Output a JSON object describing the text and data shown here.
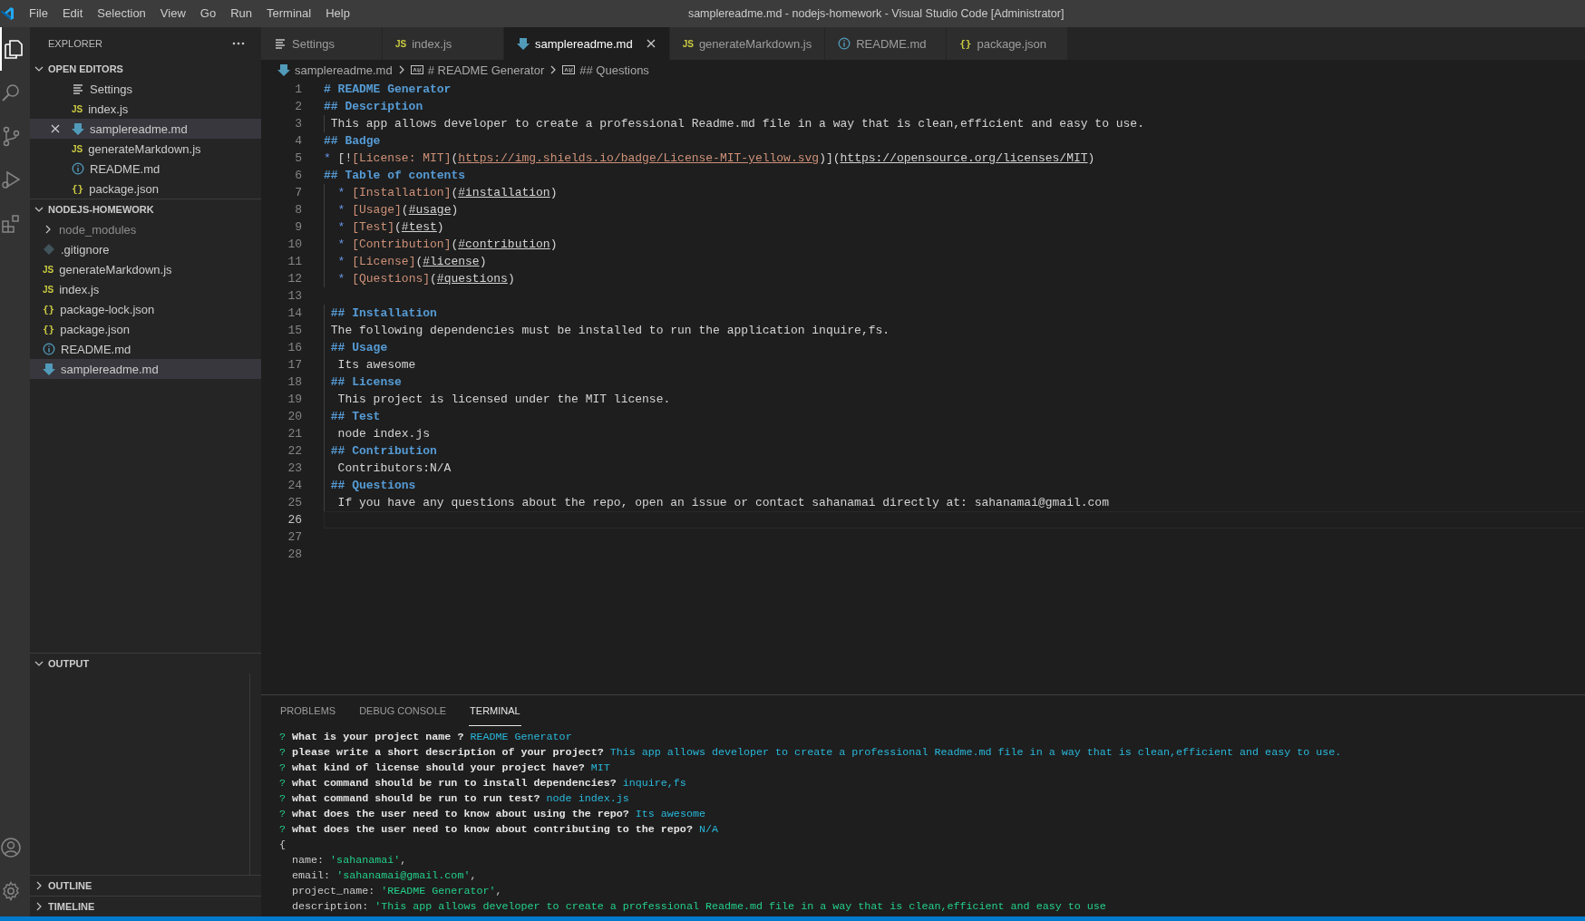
{
  "title_bar": {
    "menu": [
      "File",
      "Edit",
      "Selection",
      "View",
      "Go",
      "Run",
      "Terminal",
      "Help"
    ],
    "title": "samplereadme.md - nodejs-homework - Visual Studio Code [Administrator]"
  },
  "activity_bar": {
    "items": [
      {
        "kind": "files",
        "selected": true
      },
      {
        "kind": "search",
        "selected": false
      },
      {
        "kind": "source-control",
        "selected": false
      },
      {
        "kind": "run",
        "selected": false
      },
      {
        "kind": "extensions",
        "selected": false
      }
    ],
    "bottom": [
      {
        "kind": "account"
      },
      {
        "kind": "settings"
      }
    ]
  },
  "sidebar": {
    "title": "EXPLORER",
    "sections": [
      {
        "title": "OPEN EDITORS",
        "expanded": true,
        "items": [
          {
            "label": "Settings",
            "kind": "settings",
            "selected": false
          },
          {
            "label": "index.js",
            "kind": "js",
            "badge": "JS",
            "selected": false
          },
          {
            "label": "samplereadme.md",
            "kind": "markdown",
            "selected": true
          },
          {
            "label": "generateMarkdown.js",
            "kind": "js",
            "badge": "JS",
            "selected": false
          },
          {
            "label": "README.md",
            "kind": "info",
            "selected": false
          },
          {
            "label": "package.json",
            "kind": "json",
            "badge": "{}",
            "selected": false
          }
        ]
      },
      {
        "title": "NODEJS-HOMEWORK",
        "expanded": true,
        "items": [
          {
            "label": "node_modules",
            "kind": "folder",
            "expanded": false,
            "ignored": true,
            "selected": false
          },
          {
            "label": ".gitignore",
            "kind": "gitignore",
            "ignored": false,
            "selected": false
          },
          {
            "label": "generateMarkdown.js",
            "kind": "js",
            "badge": "JS",
            "ignored": false,
            "selected": false
          },
          {
            "label": "index.js",
            "kind": "js",
            "badge": "JS",
            "ignored": false,
            "selected": false
          },
          {
            "label": "package-lock.json",
            "kind": "json",
            "badge": "{}",
            "ignored": false,
            "selected": false
          },
          {
            "label": "package.json",
            "kind": "json",
            "badge": "{}",
            "ignored": false,
            "selected": false
          },
          {
            "label": "README.md",
            "kind": "info",
            "ignored": false,
            "selected": false
          },
          {
            "label": "samplereadme.md",
            "kind": "markdown",
            "ignored": false,
            "selected": true
          }
        ]
      },
      {
        "title": "OUTPUT",
        "expanded": true
      },
      {
        "title": "OUTLINE",
        "expanded": false
      },
      {
        "title": "TIMELINE",
        "expanded": false
      }
    ]
  },
  "editor": {
    "tabs": [
      {
        "label": "Settings",
        "kind": "settings",
        "selected": false
      },
      {
        "label": "index.js",
        "kind": "js",
        "badge": "JS",
        "selected": false
      },
      {
        "label": "samplereadme.md",
        "kind": "markdown",
        "selected": true
      },
      {
        "label": "generateMarkdown.js",
        "kind": "js",
        "badge": "JS",
        "selected": false
      },
      {
        "label": "README.md",
        "kind": "info",
        "selected": false
      },
      {
        "label": "package.json",
        "kind": "json",
        "badge": "{}",
        "selected": false
      }
    ],
    "breadcrumb": [
      {
        "label": "samplereadme.md",
        "kind": "markdown"
      },
      {
        "label": "# README Generator",
        "kind": "symbol"
      },
      {
        "label": "## Questions",
        "kind": "symbol"
      }
    ],
    "lines": [
      {
        "number": "1",
        "current": false,
        "indent_guide": false,
        "segments": [
          {
            "kind": "heading",
            "text": "# README Generator"
          }
        ]
      },
      {
        "number": "2",
        "current": false,
        "indent_guide": false,
        "segments": [
          {
            "kind": "heading",
            "text": "## Description"
          }
        ]
      },
      {
        "number": "3",
        "current": false,
        "indent_guide": true,
        "segments": [
          {
            "kind": "plain",
            "text": " This app allows developer to create a professional Readme.md file in a way that is clean,efficient and easy to use."
          }
        ]
      },
      {
        "number": "4",
        "current": false,
        "indent_guide": false,
        "segments": [
          {
            "kind": "heading",
            "text": "## Badge"
          }
        ]
      },
      {
        "number": "5",
        "current": false,
        "indent_guide": false,
        "segments": [
          {
            "kind": "bullet",
            "text": "* "
          },
          {
            "kind": "plain",
            "text": "[!"
          },
          {
            "kind": "link_text",
            "text": "[License: MIT]"
          },
          {
            "kind": "plain",
            "text": "("
          },
          {
            "kind": "image_url",
            "text": "https://img.shields.io/badge/License-MIT-yellow.svg"
          },
          {
            "kind": "plain",
            "text": ")]("
          },
          {
            "kind": "link_url",
            "text": "https://opensource.org/licenses/MIT"
          },
          {
            "kind": "plain",
            "text": ")"
          }
        ]
      },
      {
        "number": "6",
        "current": false,
        "indent_guide": false,
        "segments": [
          {
            "kind": "heading",
            "text": "## Table of contents"
          }
        ]
      },
      {
        "number": "7",
        "current": false,
        "indent_guide": true,
        "segments": [
          {
            "kind": "bullet",
            "text": "  * "
          },
          {
            "kind": "link_text",
            "text": "[Installation]"
          },
          {
            "kind": "plain",
            "text": "("
          },
          {
            "kind": "link_url",
            "text": "#installation"
          },
          {
            "kind": "plain",
            "text": ")"
          }
        ]
      },
      {
        "number": "8",
        "current": false,
        "indent_guide": true,
        "segments": [
          {
            "kind": "bullet",
            "text": "  * "
          },
          {
            "kind": "link_text",
            "text": "[Usage]"
          },
          {
            "kind": "plain",
            "text": "("
          },
          {
            "kind": "link_url",
            "text": "#usage"
          },
          {
            "kind": "plain",
            "text": ")"
          }
        ]
      },
      {
        "number": "9",
        "current": false,
        "indent_guide": true,
        "segments": [
          {
            "kind": "bullet",
            "text": "  * "
          },
          {
            "kind": "link_text",
            "text": "[Test]"
          },
          {
            "kind": "plain",
            "text": "("
          },
          {
            "kind": "link_url",
            "text": "#test"
          },
          {
            "kind": "plain",
            "text": ")"
          }
        ]
      },
      {
        "number": "10",
        "current": false,
        "indent_guide": true,
        "segments": [
          {
            "kind": "bullet",
            "text": "  * "
          },
          {
            "kind": "link_text",
            "text": "[Contribution]"
          },
          {
            "kind": "plain",
            "text": "("
          },
          {
            "kind": "link_url",
            "text": "#contribution"
          },
          {
            "kind": "plain",
            "text": ")"
          }
        ]
      },
      {
        "number": "11",
        "current": false,
        "indent_guide": true,
        "segments": [
          {
            "kind": "bullet",
            "text": "  * "
          },
          {
            "kind": "link_text",
            "text": "[License]"
          },
          {
            "kind": "plain",
            "text": "("
          },
          {
            "kind": "link_url",
            "text": "#license"
          },
          {
            "kind": "plain",
            "text": ")"
          }
        ]
      },
      {
        "number": "12",
        "current": false,
        "indent_guide": true,
        "segments": [
          {
            "kind": "bullet",
            "text": "  * "
          },
          {
            "kind": "link_text",
            "text": "[Questions]"
          },
          {
            "kind": "plain",
            "text": "("
          },
          {
            "kind": "link_url",
            "text": "#questions"
          },
          {
            "kind": "plain",
            "text": ")"
          }
        ]
      },
      {
        "number": "13",
        "current": false,
        "indent_guide": false
      },
      {
        "number": "14",
        "current": false,
        "indent_guide": true,
        "segments": [
          {
            "kind": "heading",
            "text": " ## Installation"
          }
        ]
      },
      {
        "number": "15",
        "current": false,
        "indent_guide": true,
        "segments": [
          {
            "kind": "plain",
            "text": " The following dependencies must be installed to run the application inquire,fs."
          }
        ]
      },
      {
        "number": "16",
        "current": false,
        "indent_guide": true,
        "segments": [
          {
            "kind": "heading",
            "text": " ## Usage"
          }
        ]
      },
      {
        "number": "17",
        "current": false,
        "indent_guide": true,
        "segments": [
          {
            "kind": "plain",
            "text": "  Its awesome"
          }
        ]
      },
      {
        "number": "18",
        "current": false,
        "indent_guide": true,
        "segments": [
          {
            "kind": "heading",
            "text": " ## License"
          }
        ]
      },
      {
        "number": "19",
        "current": false,
        "indent_guide": true,
        "segments": [
          {
            "kind": "plain",
            "text": "  This project is licensed under the MIT license."
          }
        ]
      },
      {
        "number": "20",
        "current": false,
        "indent_guide": true,
        "segments": [
          {
            "kind": "heading",
            "text": " ## Test"
          }
        ]
      },
      {
        "number": "21",
        "current": false,
        "indent_guide": true,
        "segments": [
          {
            "kind": "plain",
            "text": "  node index.js"
          }
        ]
      },
      {
        "number": "22",
        "current": false,
        "indent_guide": true,
        "segments": [
          {
            "kind": "heading",
            "text": " ## Contribution"
          }
        ]
      },
      {
        "number": "23",
        "current": false,
        "indent_guide": true,
        "segments": [
          {
            "kind": "plain",
            "text": "  Contributors:N/A"
          }
        ]
      },
      {
        "number": "24",
        "current": false,
        "indent_guide": true,
        "segments": [
          {
            "kind": "heading",
            "text": " ## Questions"
          }
        ]
      },
      {
        "number": "25",
        "current": false,
        "indent_guide": true,
        "segments": [
          {
            "kind": "plain",
            "text": "  If you have any questions about the repo, open an issue or contact sahanamai directly at: sahanamai@gmail.com"
          }
        ]
      },
      {
        "number": "26",
        "current": true,
        "indent_guide": false
      },
      {
        "number": "27",
        "current": false,
        "indent_guide": false
      },
      {
        "number": "28",
        "current": false,
        "indent_guide": false
      }
    ]
  },
  "panel": {
    "tabs": [
      {
        "label": "PROBLEMS",
        "selected": false
      },
      {
        "label": "DEBUG CONSOLE",
        "selected": false
      },
      {
        "label": "TERMINAL",
        "selected": true
      }
    ],
    "terminal": [
      {
        "kind": "prompt",
        "mark": "?",
        "question": "What is your project name ?",
        "answer": "README Generator"
      },
      {
        "kind": "prompt",
        "mark": "?",
        "question": "please write a short description of your project?",
        "answer": "This app allows developer to create a professional Readme.md file in a way that is clean,efficient and easy to use."
      },
      {
        "kind": "prompt",
        "mark": "?",
        "question": "what kind of license should your project have?",
        "answer": "MIT"
      },
      {
        "kind": "prompt",
        "mark": "?",
        "question": "what command should be run to install dependencies?",
        "answer": "inquire,fs"
      },
      {
        "kind": "prompt",
        "mark": "?",
        "question": "what command should be run to run test?",
        "answer": "node index.js"
      },
      {
        "kind": "prompt",
        "mark": "?",
        "question": "what does the user need to know about using the repo?",
        "answer": "Its awesome"
      },
      {
        "kind": "prompt",
        "mark": "?",
        "question": "what does the user need to know about contributing to the repo?",
        "answer": "N/A"
      },
      {
        "kind": "plain",
        "text": "{"
      },
      {
        "kind": "property",
        "key": "  name: ",
        "value": "'sahanamai'",
        "suffix": ","
      },
      {
        "kind": "property",
        "key": "  email: ",
        "value": "'sahanamai@gmail.com'",
        "suffix": ","
      },
      {
        "kind": "property",
        "key": "  project_name: ",
        "value": "'README Generator'",
        "suffix": ","
      },
      {
        "kind": "property",
        "key": "  description: ",
        "value": "'This app allows developer to create a professional Readme.md file in a way that is clean,efficient and easy to use"
      }
    ]
  }
}
